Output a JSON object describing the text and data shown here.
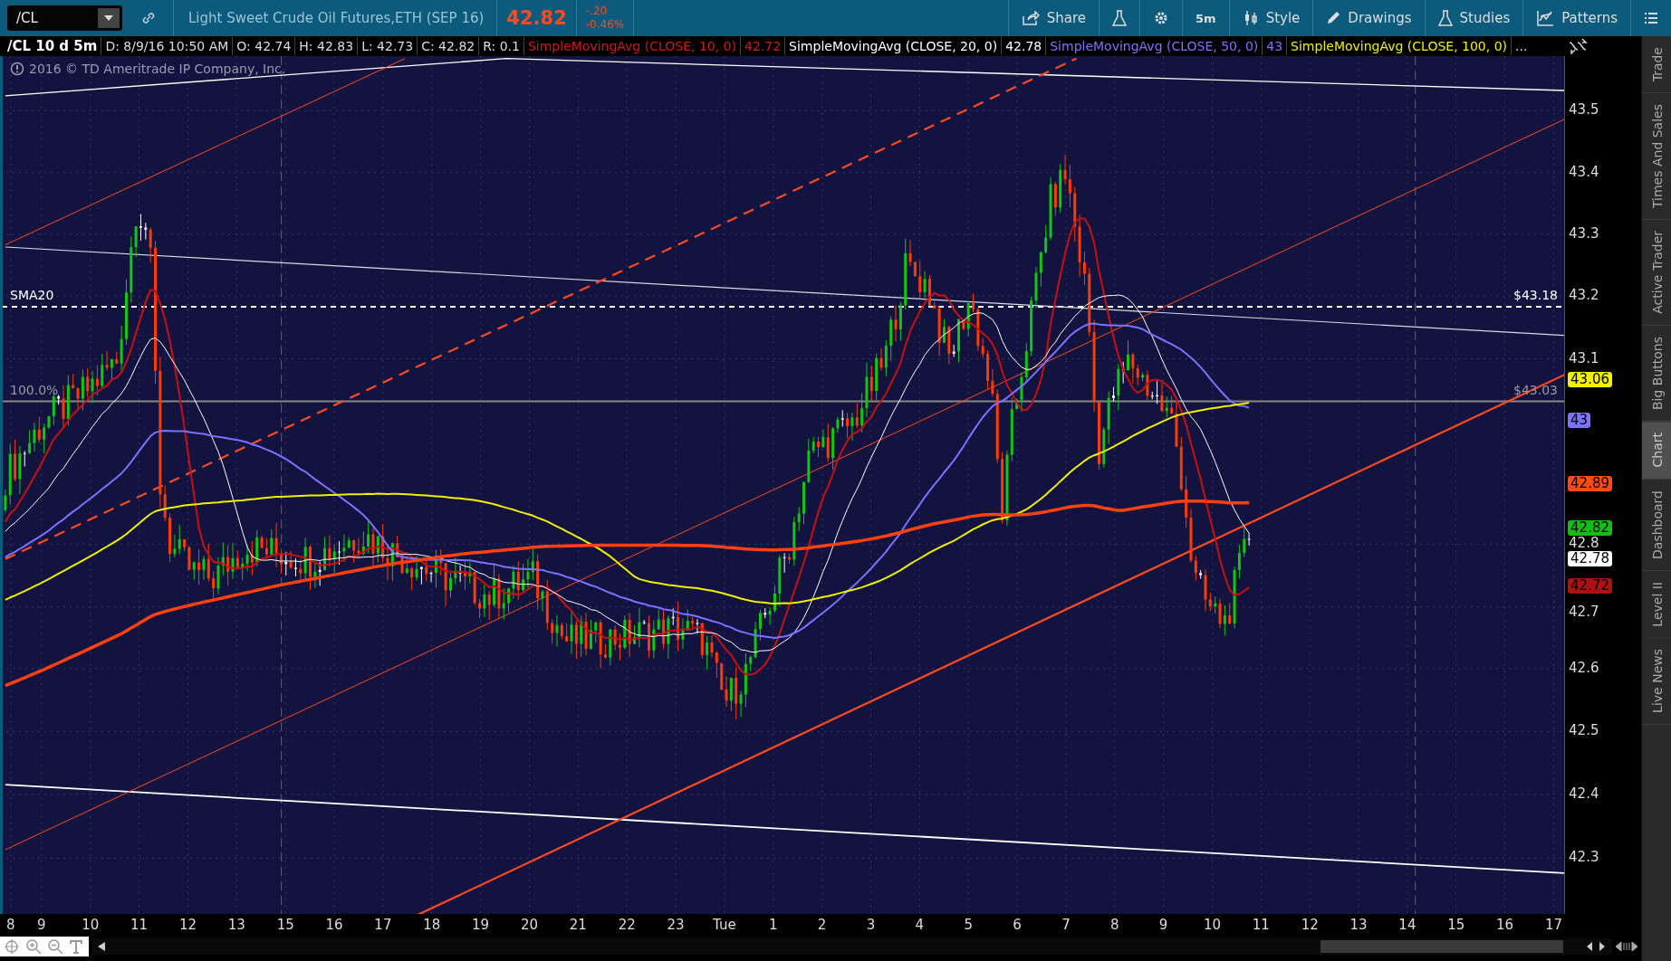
{
  "toolbar": {
    "symbol": "/CL",
    "description": "Light Sweet Crude Oil Futures,ETH (SEP 16)",
    "last": "42.82",
    "change": "-.20",
    "change_pct": "-0.46%",
    "buttons": [
      {
        "kind": "share",
        "label": "Share"
      },
      {
        "kind": "flask"
      },
      {
        "kind": "gear"
      },
      {
        "kind": "text",
        "label": "5m"
      },
      {
        "kind": "style",
        "label": "Style"
      },
      {
        "kind": "pencil",
        "label": "Drawings"
      },
      {
        "kind": "flask",
        "label": "Studies"
      },
      {
        "kind": "patterns",
        "label": "Patterns"
      },
      {
        "kind": "list"
      }
    ]
  },
  "legend": {
    "title": "/CL 10 d 5m",
    "fields": [
      "D: 8/9/16 10:50 AM",
      "O: 42.74",
      "H: 42.83",
      "L: 42.73",
      "C: 42.82",
      "R: 0.1"
    ],
    "studies": [
      {
        "name": "SimpleMovingAvg (CLOSE, 10, 0)",
        "value": "42.72"
      },
      {
        "name": "SimpleMovingAvg (CLOSE, 20, 0)",
        "value": "42.78"
      },
      {
        "name": "SimpleMovingAvg (CLOSE, 50, 0)",
        "value": "43"
      },
      {
        "name": "SimpleMovingAvg (CLOSE, 100, 0)"
      }
    ],
    "more": "..."
  },
  "copyright": "2016 © TD Ameritrade IP Company, Inc.",
  "chart": {
    "y_ticks": [
      "43.5",
      "43.4",
      "43.3",
      "43.2",
      "43.1",
      "42.8",
      "42.7",
      "42.6",
      "42.5",
      "42.4",
      "42.3"
    ],
    "x_ticks": [
      "8",
      "9",
      "10",
      "11",
      "12",
      "13",
      "15",
      "16",
      "17",
      "18",
      "19",
      "20",
      "21",
      "22",
      "23",
      "Tue",
      "1",
      "2",
      "3",
      "4",
      "5",
      "6",
      "7",
      "8",
      "9",
      "10",
      "11",
      "12",
      "13",
      "14",
      "15",
      "16",
      "17"
    ],
    "levels": [
      {
        "kind": "dashed",
        "label": "SMA20",
        "price": "$43.18"
      },
      {
        "kind": "solid",
        "label": "100.0%",
        "price": "$43.03"
      }
    ],
    "badges": [
      {
        "value": "43.06",
        "color": "#f0f000"
      },
      {
        "value": "43",
        "color": "#7b72ff"
      },
      {
        "value": "42.89",
        "color": "#ff4a10"
      },
      {
        "value": "42.82",
        "color": "#10c010"
      },
      {
        "value": "42.78",
        "color": "#ffffff"
      },
      {
        "value": "42.72",
        "color": "#b01010"
      }
    ]
  },
  "side_tabs": [
    {
      "label": "Trade",
      "selected": false
    },
    {
      "label": "Times And Sales",
      "selected": false
    },
    {
      "label": "Active Trader",
      "selected": false
    },
    {
      "label": "Big Buttons",
      "selected": false
    },
    {
      "label": "Chart",
      "selected": true
    },
    {
      "label": "Dashboard",
      "selected": false
    },
    {
      "label": "Level II",
      "selected": false
    },
    {
      "label": "Live News",
      "selected": false
    }
  ]
}
